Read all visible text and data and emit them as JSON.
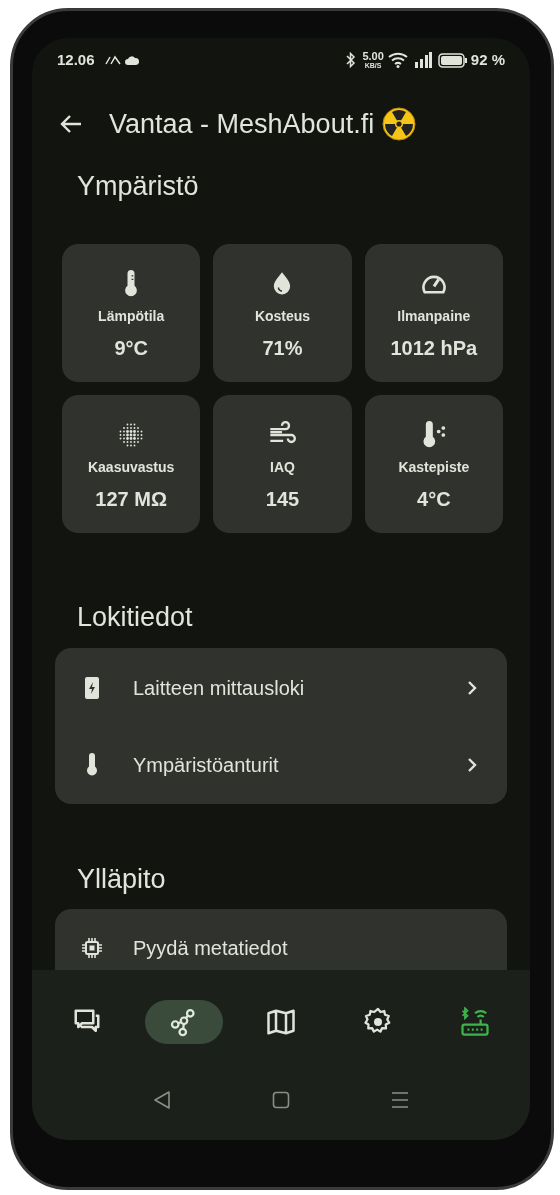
{
  "status_bar": {
    "time": "12.06",
    "net_speed": "5.00",
    "net_unit": "KB/S",
    "battery": "92 %"
  },
  "app_bar": {
    "title": "Vantaa - MeshAbout.fi"
  },
  "environment": {
    "title": "Ympäristö",
    "tiles": [
      {
        "label": "Lämpötila",
        "value": "9°C"
      },
      {
        "label": "Kosteus",
        "value": "71%"
      },
      {
        "label": "Ilmanpaine",
        "value": "1012 hPa"
      },
      {
        "label": "Kaasuvastus",
        "value": "127 MΩ"
      },
      {
        "label": "IAQ",
        "value": "145"
      },
      {
        "label": "Kastepiste",
        "value": "4°C"
      }
    ]
  },
  "logs": {
    "title": "Lokitiedot",
    "items": [
      {
        "label": "Laitteen mittausloki"
      },
      {
        "label": "Ympäristöanturit"
      }
    ]
  },
  "maintenance": {
    "title": "Ylläpito",
    "items": [
      {
        "label": "Pyydä metatiedot"
      }
    ]
  },
  "bottom_nav": [
    {
      "selected": false
    },
    {
      "selected": true
    },
    {
      "selected": false
    },
    {
      "selected": false
    },
    {
      "selected": false,
      "kind": "connection",
      "connected": true
    }
  ]
}
